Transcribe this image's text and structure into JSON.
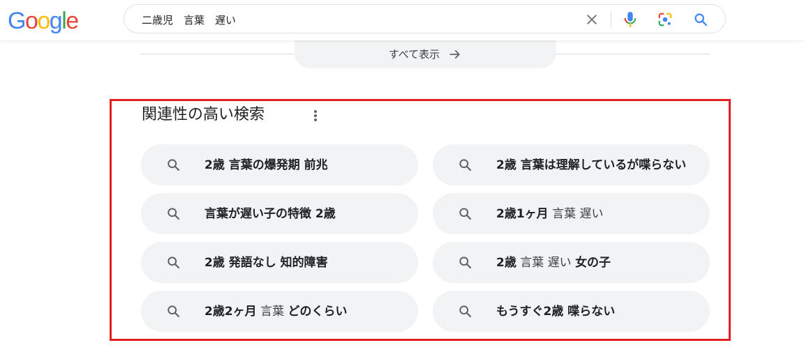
{
  "header": {
    "logo_letters": [
      {
        "ch": "G",
        "color": "#4285F4"
      },
      {
        "ch": "o",
        "color": "#EA4335"
      },
      {
        "ch": "o",
        "color": "#FBBC05"
      },
      {
        "ch": "g",
        "color": "#4285F4"
      },
      {
        "ch": "l",
        "color": "#34A853"
      },
      {
        "ch": "e",
        "color": "#EA4335"
      }
    ],
    "search_query": "二歳児　言葉　遅い",
    "icons": {
      "clear": "close-icon",
      "voice": "microphone-icon",
      "lens": "camera-lens-icon",
      "search": "search-icon"
    }
  },
  "show_all": {
    "label": "すべて表示",
    "icon": "arrow-right-icon"
  },
  "related": {
    "title": "関連性の高い検索",
    "more_icon": "three-dots-vertical-icon",
    "items": [
      [
        {
          "t": "2歳 言葉の爆発期 前兆",
          "b": true
        }
      ],
      [
        {
          "t": "2歳 言葉は理解しているが喋らない",
          "b": true
        }
      ],
      [
        {
          "t": "言葉が遅い子の特徴 2歳",
          "b": true
        }
      ],
      [
        {
          "t": "2歳1ヶ月",
          "b": true
        },
        {
          "t": " 言葉 遅い",
          "b": false
        }
      ],
      [
        {
          "t": "2歳 発語なし 知的障害",
          "b": true
        }
      ],
      [
        {
          "t": "2歳",
          "b": true
        },
        {
          "t": " 言葉 遅い ",
          "b": false
        },
        {
          "t": "女の子",
          "b": true
        }
      ],
      [
        {
          "t": "2歳2ヶ月",
          "b": true
        },
        {
          "t": " 言葉 ",
          "b": false
        },
        {
          "t": "どのくらい",
          "b": true
        }
      ],
      [
        {
          "t": "もうすぐ2歳 喋らない",
          "b": true
        }
      ]
    ]
  },
  "colors": {
    "highlight_frame": "#e02020",
    "chip_background": "#f1f3f4",
    "search_icon_blue": "#4285F4"
  }
}
